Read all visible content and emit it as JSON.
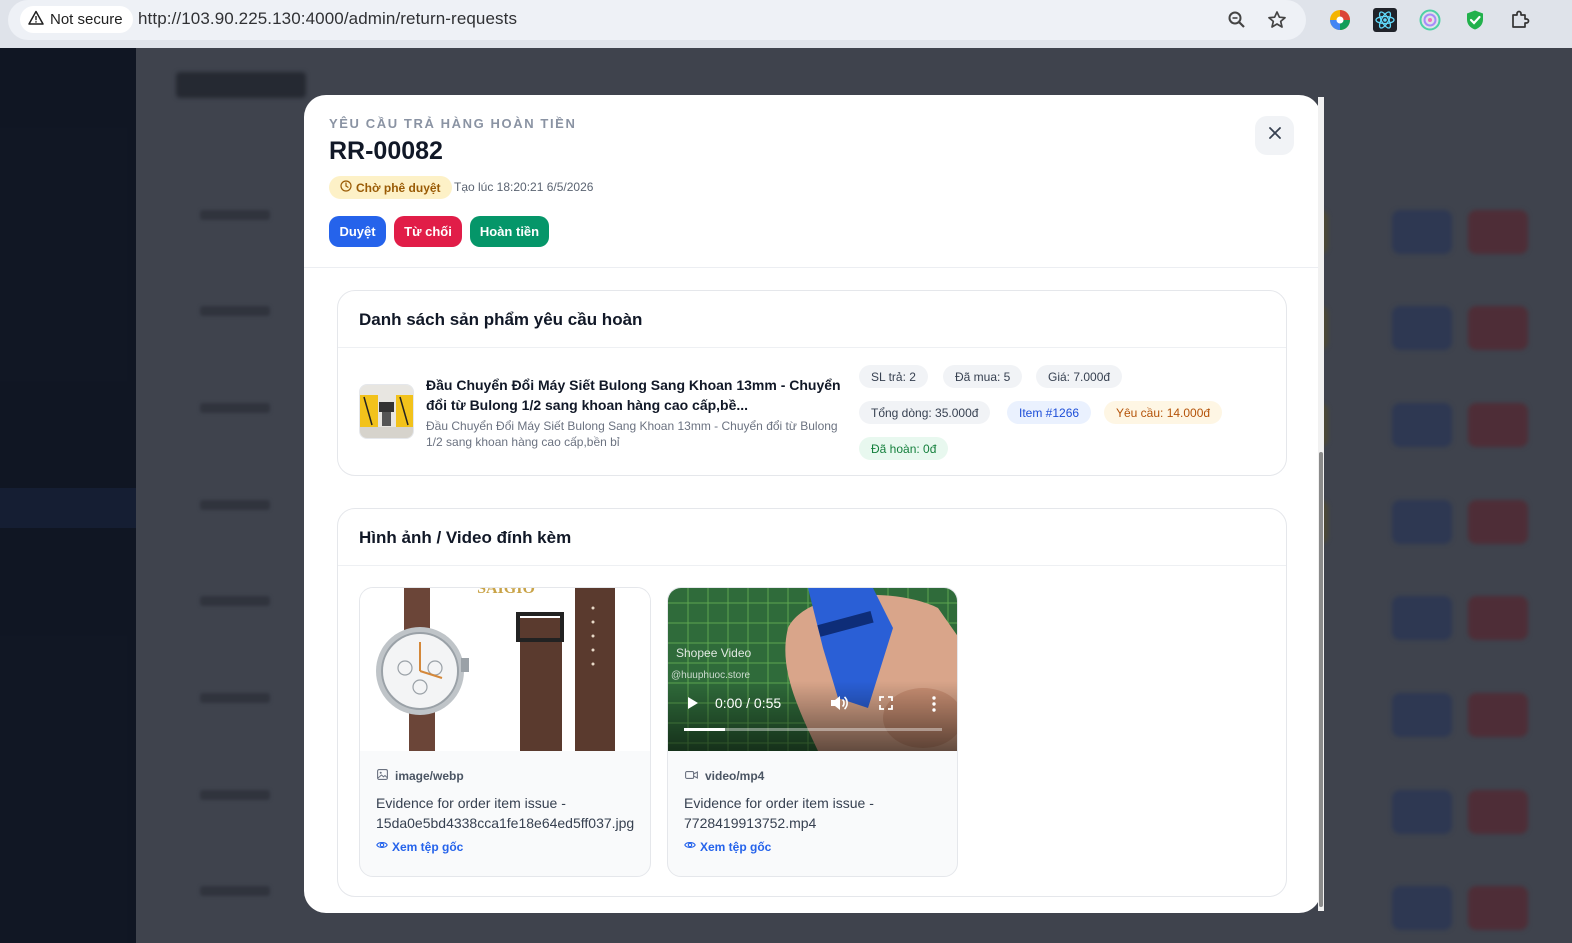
{
  "browser": {
    "security_label": "Not secure",
    "url": "http://103.90.225.130:4000/admin/return-requests"
  },
  "modal": {
    "eyebrow": "YÊU CẦU TRẢ HÀNG HOÀN TIỀN",
    "request_id": "RR-00082",
    "status": "Chờ phê duyệt",
    "created": "Tạo lúc 18:20:21 6/5/2026",
    "actions": {
      "approve": "Duyệt",
      "reject": "Từ chối",
      "refund": "Hoàn tiền"
    },
    "colors": {
      "approve": "#2563eb",
      "reject": "#e11d48",
      "refund": "#059669",
      "status_bg": "#fdf1c7",
      "status_text": "#9a5b05"
    }
  },
  "products": {
    "title": "Danh sách sản phẩm yêu cầu hoàn",
    "items": [
      {
        "name": "Đầu Chuyển Đổi Máy Siết Bulong Sang Khoan 13mm - Chuyển đổi từ Bulong 1/2 sang khoan hàng cao cấp,bề...",
        "description": "Đầu Chuyển Đổi Máy Siết Bulong Sang Khoan 13mm - Chuyển đổi từ Bulong 1/2 sang khoan hàng cao cấp,bền bỉ",
        "qty_return": "SL trả: 2",
        "qty_bought": "Đã mua: 5",
        "price": "Giá: 7.000đ",
        "line_total": "Tổng dòng: 35.000đ",
        "item_ref": "Item #1266",
        "requested": "Yêu cầu: 14.000đ",
        "refunded": "Đã hoàn: 0đ"
      }
    ]
  },
  "attachments": {
    "title": "Hình ảnh / Video đính kèm",
    "items": [
      {
        "type": "image/webp",
        "icon": "image-icon",
        "caption": "Evidence for order item issue - 15da0e5bd4338cca1fe18e64ed5ff037.jpg",
        "link": "Xem tệp gốc",
        "watermark": "SAIGIO"
      },
      {
        "type": "video/mp4",
        "icon": "video-icon",
        "caption": "Evidence for order item issue - 7728419913752.mp4",
        "link": "Xem tệp gốc",
        "time": "0:00 / 0:55",
        "progress": 0.16,
        "watermark_brand": "Shopee Video",
        "watermark_handle": "@huuphuoc.store"
      }
    ]
  }
}
